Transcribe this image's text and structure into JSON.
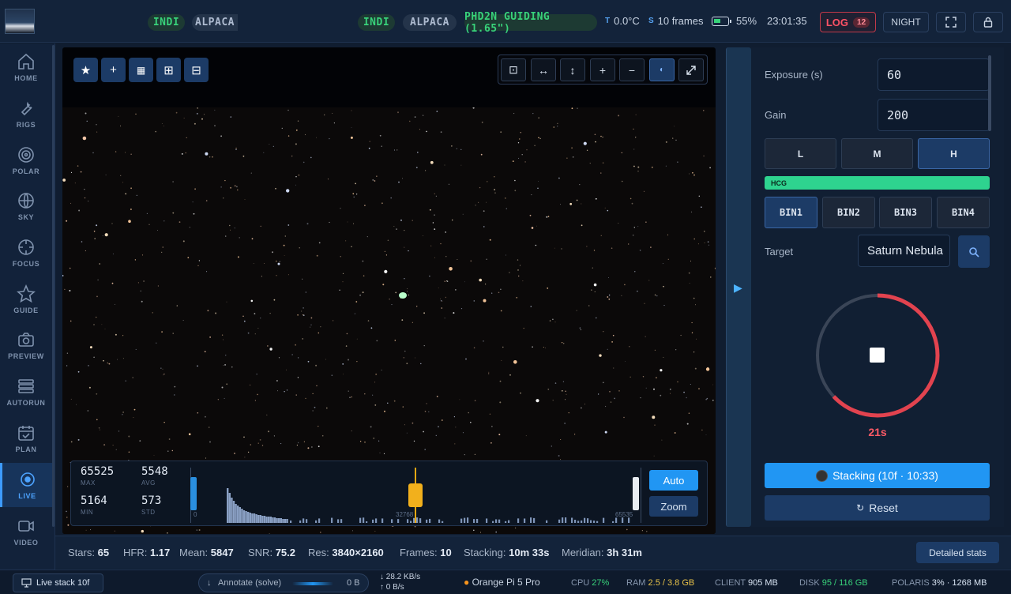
{
  "topbar": {
    "pills_left": [
      "INDI",
      "ALPACA"
    ],
    "pills_right": [
      "INDI",
      "ALPACA",
      "PHD2N GUIDING (1.65\")"
    ],
    "temp_tag": "T",
    "temp": "0.0°C",
    "frames_tag": "S",
    "frames": "10 frames",
    "battery": "55%",
    "battery_level": 0.55,
    "clock": "23:01:35",
    "log_label": "LOG",
    "log_count": "12",
    "night_label": "NIGHT"
  },
  "sidebar": {
    "items": [
      {
        "label": "HOME",
        "icon": "home-icon"
      },
      {
        "label": "RIGS",
        "icon": "wrench-icon"
      },
      {
        "label": "POLAR",
        "icon": "polar-target-icon"
      },
      {
        "label": "SKY",
        "icon": "globe-icon"
      },
      {
        "label": "FOCUS",
        "icon": "focus-crosshair-icon"
      },
      {
        "label": "GUIDE",
        "icon": "star-icon"
      },
      {
        "label": "PREVIEW",
        "icon": "camera-icon"
      },
      {
        "label": "AUTORUN",
        "icon": "stack-icon"
      },
      {
        "label": "PLAN",
        "icon": "calendar-icon"
      },
      {
        "label": "LIVE",
        "icon": "live-dot-icon"
      },
      {
        "label": "VIDEO",
        "icon": "video-icon"
      }
    ],
    "active": "LIVE"
  },
  "histogram": {
    "max": "65525",
    "max_label": "MAX",
    "avg": "5548",
    "avg_label": "AVG",
    "min": "5164",
    "min_label": "MIN",
    "std": "573",
    "std_label": "STD",
    "axis_start": "0",
    "axis_mid": "32768",
    "axis_end": "65535",
    "auto_label": "Auto",
    "zoom_label": "Zoom"
  },
  "camera": {
    "exposure_label": "Exposure (s)",
    "exposure_value": "60",
    "gain_label": "Gain",
    "gain_value": "200",
    "gain_modes": [
      "L",
      "M",
      "H"
    ],
    "gain_mode_active": "H",
    "hcg_label": "HCG",
    "bins": [
      "BIN1",
      "BIN2",
      "BIN3",
      "BIN4"
    ],
    "bin_active": "BIN1",
    "target_label": "Target",
    "target_value": "Saturn Nebula",
    "countdown": "21s",
    "countdown_progress": 0.63,
    "stacking_label": "Stacking (10f · 10:33)",
    "reset_label": "Reset"
  },
  "stats": {
    "stars_label": "Stars:",
    "stars": "65",
    "hfr_label": "HFR:",
    "hfr": "1.17",
    "mean_label": "Mean:",
    "mean": "5847",
    "snr_label": "SNR:",
    "snr": "75.2",
    "res_label": "Res:",
    "res": "3840×2160",
    "frames_label": "Frames:",
    "frames": "10",
    "stacking_label": "Stacking:",
    "stacking": "10m 33s",
    "meridian_label": "Meridian:",
    "meridian": "3h 31m",
    "detail_button": "Detailed stats"
  },
  "footer": {
    "live_stack": "Live stack 10f",
    "annotate": "Annotate (solve)",
    "annotate_size": "0 B",
    "down_rate": "28.2 KB/s",
    "up_rate": "0 B/s",
    "device": "Orange Pi 5 Pro",
    "cpu_label": "CPU",
    "cpu": "27%",
    "ram_label": "RAM",
    "ram": "2.5 / 3.8 GB",
    "client_label": "CLIENT",
    "client": "905 MB",
    "disk_label": "DISK",
    "disk": "95 / 116 GB",
    "polaris_label": "POLARIS",
    "polaris": "3% · 1268 MB"
  },
  "colors": {
    "accent": "#2196f3",
    "green": "#38d27a",
    "red": "#e2434f",
    "hcg": "#2ed38f",
    "bg": "#101d30"
  }
}
